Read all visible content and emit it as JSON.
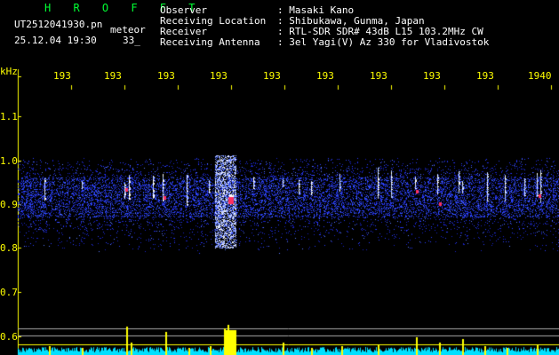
{
  "header": {
    "brand": "H R O F F T",
    "filename": "UT2512041930.pn",
    "meteor_label": "meteor",
    "datetime": "25.12.04 19:30",
    "count": "33_",
    "info": [
      {
        "label": "Observer",
        "value": ": Masaki Kano"
      },
      {
        "label": "Receiving Location",
        "value": ": Shibukawa, Gunma, Japan"
      },
      {
        "label": "Receiver",
        "value": ": RTL-SDR SDR# 43dB L15 103.2MHz CW"
      },
      {
        "label": "Receiving Antenna",
        "value": ": 3el Yagi(V) Az 330 for Vladivostok"
      }
    ]
  },
  "axes": {
    "y_unit": "kHz",
    "y_ticks": [
      "1.1",
      "1.0",
      "0.9",
      "0.8",
      "0.7",
      "0.6"
    ],
    "x_ticks": [
      "193",
      "193",
      "193",
      "193",
      "193",
      "193",
      "193",
      "193",
      "193",
      "1940"
    ]
  },
  "colors": {
    "text_yellow": "#ffff00",
    "brand_green": "#00ff33",
    "noise_blue": "#2a3cff",
    "echo_white": "#ffffff",
    "echo_red": "#ff3060",
    "baseline_cyan": "#00e0ff"
  }
}
